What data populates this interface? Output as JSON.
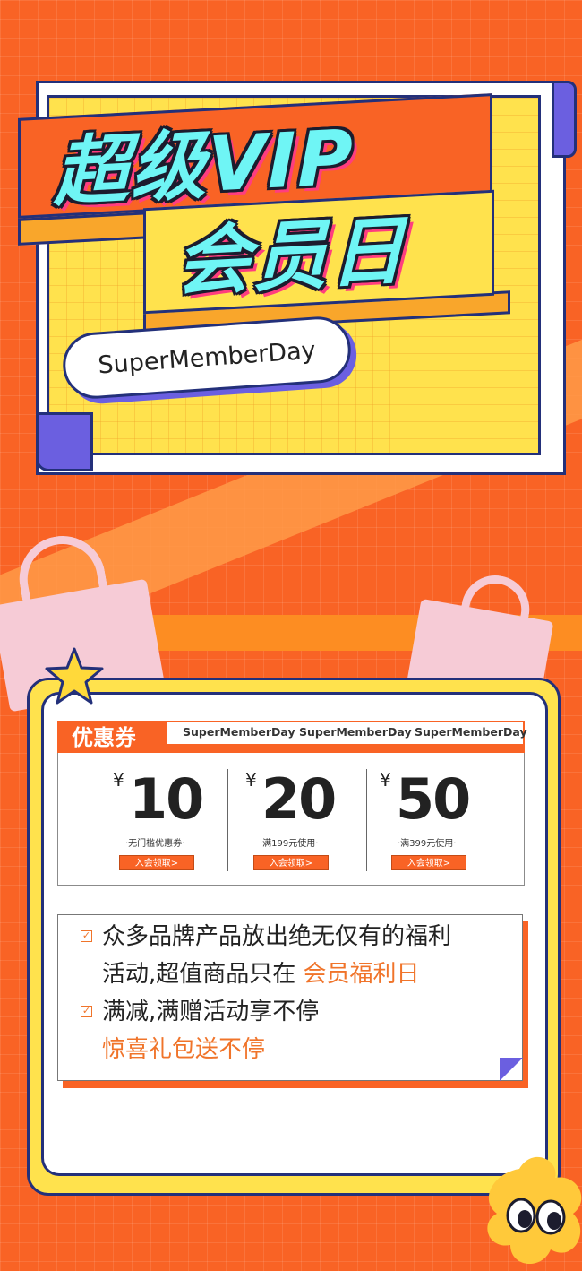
{
  "header": {
    "title_line1": "超级VIP",
    "title_line2": "会员日",
    "subtitle": "SuperMemberDay"
  },
  "coupons": {
    "section_label": "优惠券",
    "tags": [
      "SuperMemberDay",
      "SuperMemberDay",
      "SuperMemberDay"
    ],
    "currency": "¥",
    "items": [
      {
        "amount": "10",
        "condition": "·无门槛优惠券·",
        "button": "入会领取>"
      },
      {
        "amount": "20",
        "condition": "·满199元使用·",
        "button": "入会领取>"
      },
      {
        "amount": "50",
        "condition": "·满399元使用·",
        "button": "入会领取>"
      }
    ]
  },
  "benefits": {
    "check_icon": "checkbox-icon",
    "line1": "众多品牌产品放出绝无仅有的福利",
    "line2_a": "活动,超值商品只在",
    "line2_b": "会员福利日",
    "line3": "满减,满赠活动享不停",
    "line4": "惊喜礼包送不停"
  },
  "colors": {
    "background": "#f96325",
    "accent_yellow": "#ffe24d",
    "accent_purple": "#6b5fe0",
    "outline": "#23307a",
    "title_cyan": "#6ff5f5",
    "highlight": "#f0742a"
  }
}
